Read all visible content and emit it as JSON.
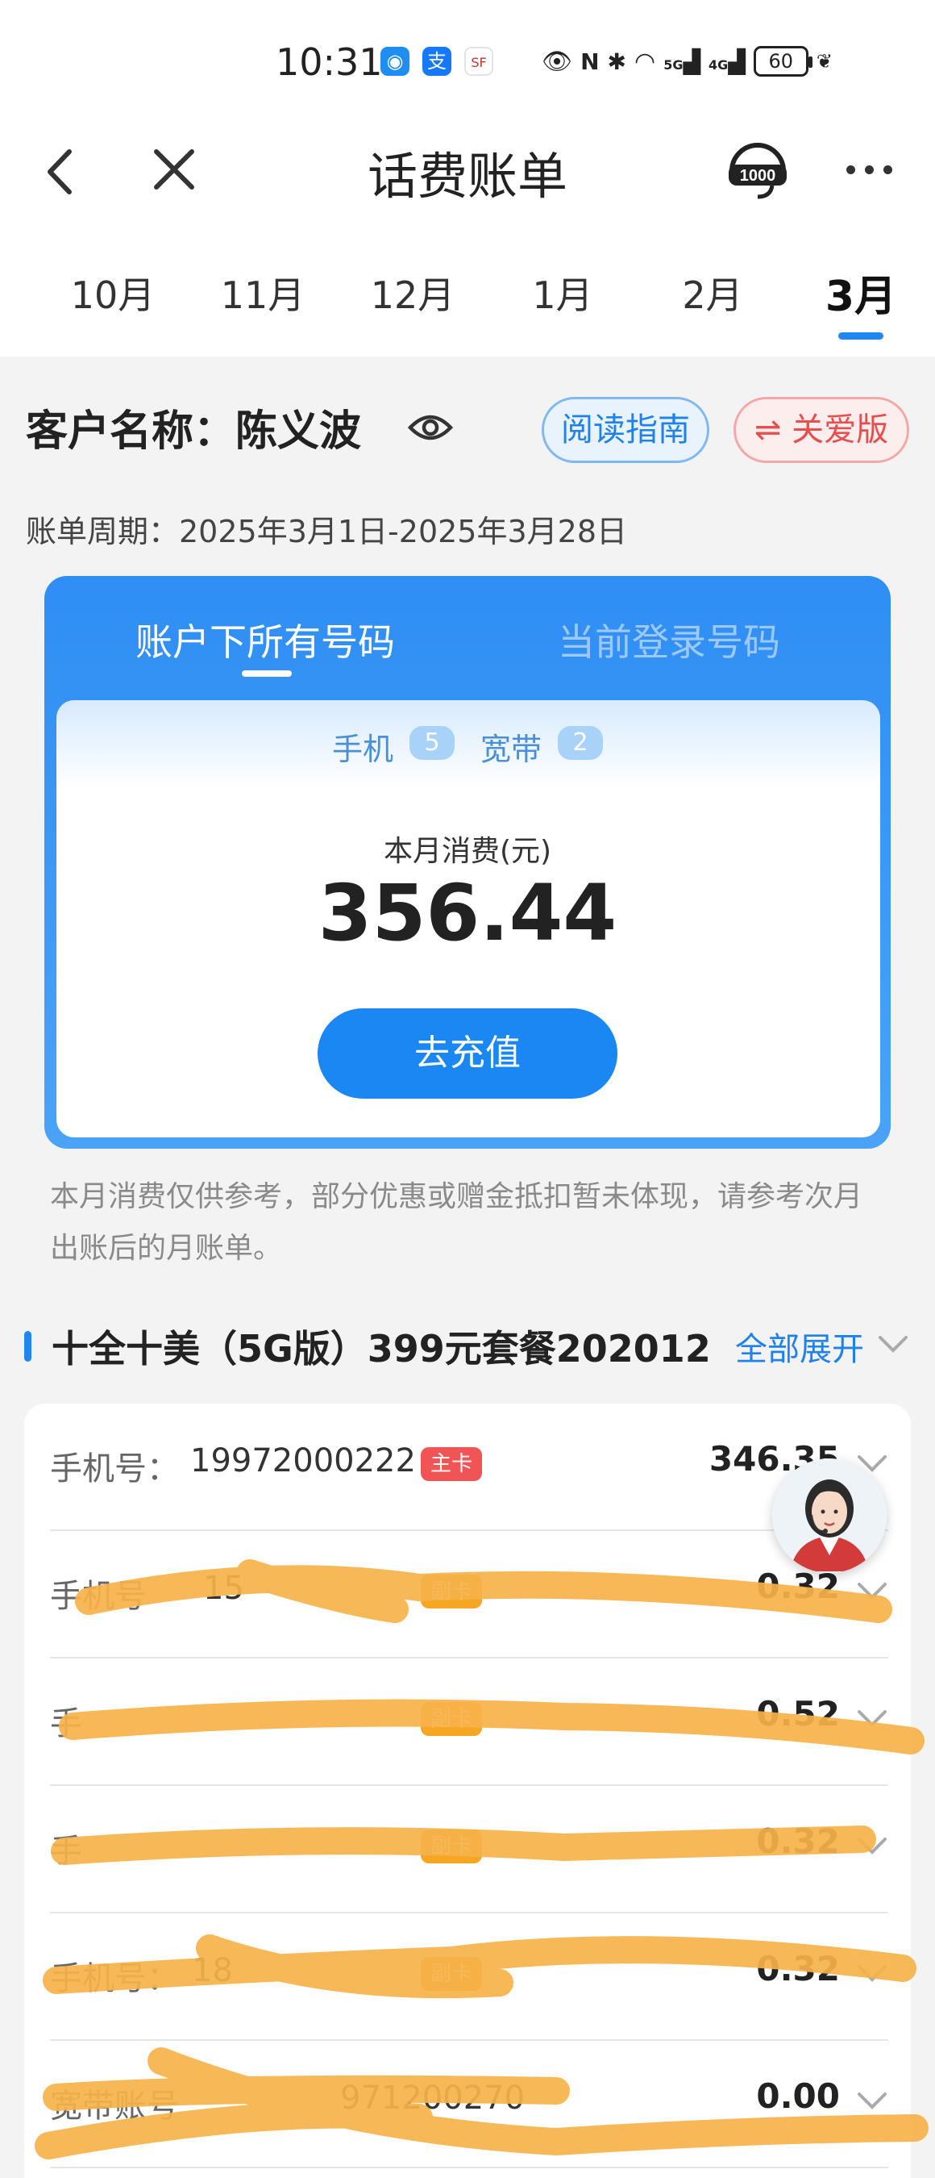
{
  "status_bar": {
    "time": "10:31",
    "network": [
      "5G",
      "4G"
    ],
    "battery": "60"
  },
  "header": {
    "title": "话费账单"
  },
  "months": [
    "10月",
    "11月",
    "12月",
    "1月",
    "2月",
    "3月"
  ],
  "active_month": "3月",
  "customer": {
    "label": "客户名称：陈义波",
    "guide_button": "阅读指南",
    "care_button": "⇌ 关爱版",
    "period": "账单周期：2025年3月1日-2025年3月28日"
  },
  "account_card": {
    "tab_all": "账户下所有号码",
    "tab_current": "当前登录号码",
    "phone_label": "手机",
    "phone_count": "5",
    "broadband_label": "宽带",
    "broadband_count": "2",
    "spend_label": "本月消费(元)",
    "spend_value": "356.44",
    "recharge_button": "去充值"
  },
  "note": "本月消费仅供参考，部分优惠或赠金抵扣暂未体现，请参考次月出账后的月账单。",
  "package": {
    "title": "十全十美（5G版）399元套餐202012",
    "expand_all": "全部展开"
  },
  "lines": [
    {
      "label": "手机号：",
      "number": "19972000222",
      "badge": "主卡",
      "amount": "346.35"
    },
    {
      "label": "手机号",
      "number": "15",
      "badge": "副卡",
      "amount": "0.32"
    },
    {
      "label": "手",
      "number": "",
      "badge": "副卡",
      "amount": "0.52"
    },
    {
      "label": "手",
      "number": "",
      "badge": "副卡",
      "amount": "0.32"
    },
    {
      "label": "手机号：",
      "number": "18",
      "badge": "副卡",
      "amount": "0.32"
    },
    {
      "label": "宽带账号",
      "number": "971200270",
      "badge": "",
      "amount": "0.00"
    }
  ],
  "colors": {
    "accent": "#1f87f5",
    "primary_badge": "#f05454",
    "secondary_badge": "#f5a623",
    "scribble": "#f7b24a"
  }
}
